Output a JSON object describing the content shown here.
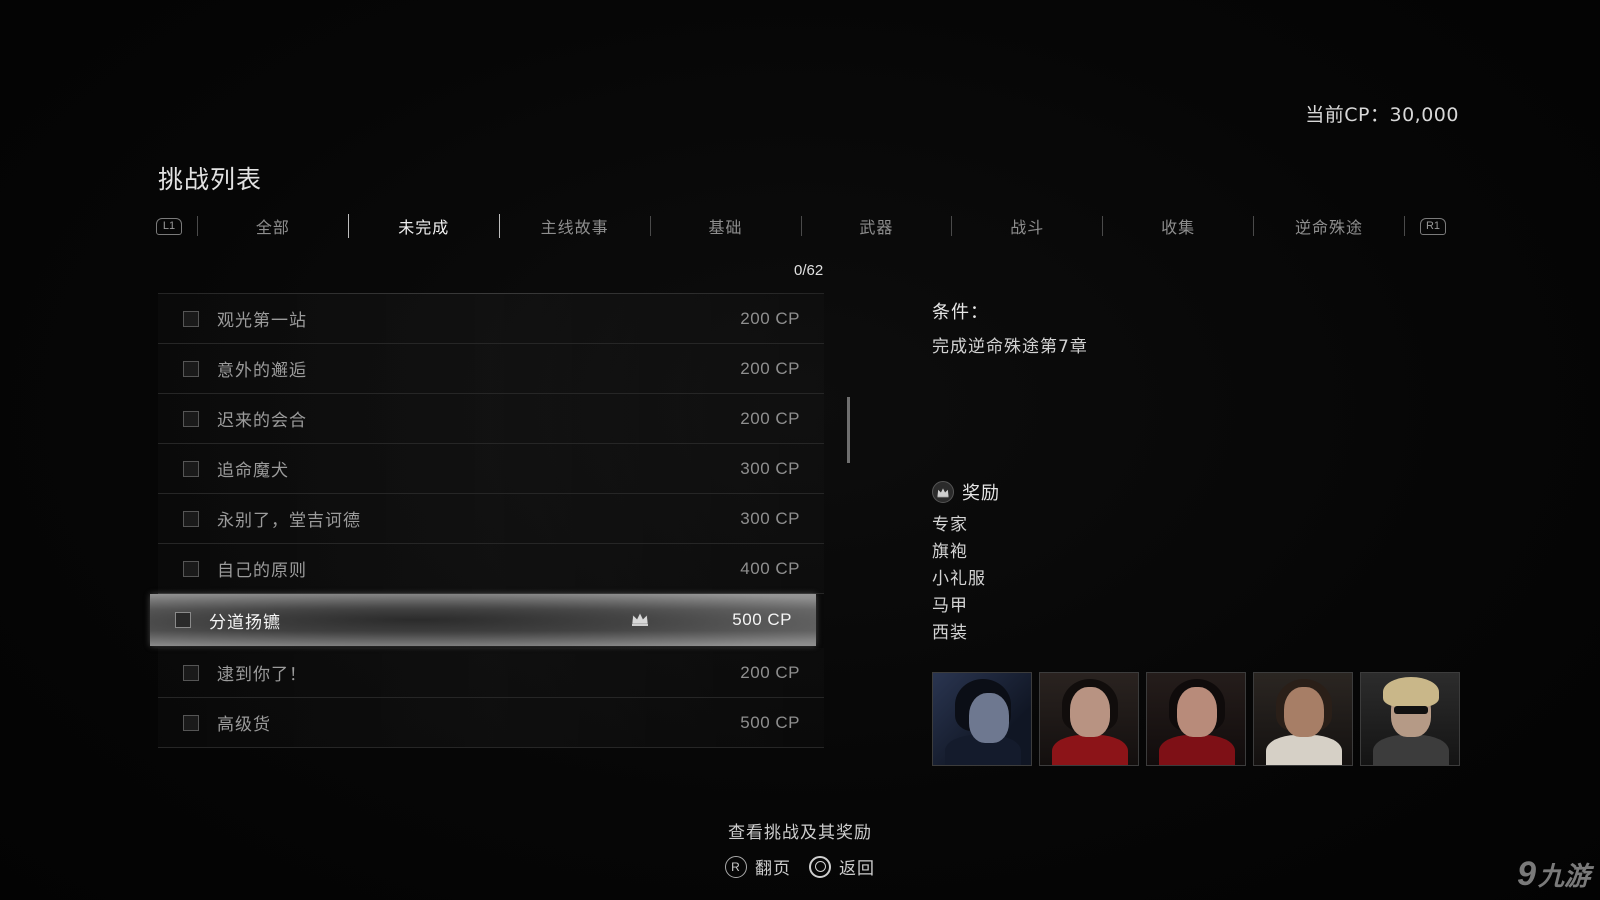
{
  "header": {
    "cp_label": "当前CP：30,000",
    "title": "挑战列表"
  },
  "tabs": {
    "left_shoulder": "L1",
    "right_shoulder": "R1",
    "items": [
      {
        "label": "全部",
        "active": false
      },
      {
        "label": "未完成",
        "active": true
      },
      {
        "label": "主线故事",
        "active": false
      },
      {
        "label": "基础",
        "active": false
      },
      {
        "label": "武器",
        "active": false
      },
      {
        "label": "战斗",
        "active": false
      },
      {
        "label": "收集",
        "active": false
      },
      {
        "label": "逆命殊途",
        "active": false
      }
    ]
  },
  "list": {
    "counter": "0/62",
    "rows": [
      {
        "name": "观光第一站",
        "cp": "200 CP",
        "selected": false
      },
      {
        "name": "意外的邂逅",
        "cp": "200 CP",
        "selected": false
      },
      {
        "name": "迟来的会合",
        "cp": "200 CP",
        "selected": false
      },
      {
        "name": "追命魔犬",
        "cp": "300 CP",
        "selected": false
      },
      {
        "name": "永别了，堂吉诃德",
        "cp": "300 CP",
        "selected": false
      },
      {
        "name": "自己的原则",
        "cp": "400 CP",
        "selected": false
      },
      {
        "name": "分道扬镳",
        "cp": "500 CP",
        "selected": true
      },
      {
        "name": "逮到你了！",
        "cp": "200 CP",
        "selected": false
      },
      {
        "name": "高级货",
        "cp": "500 CP",
        "selected": false
      }
    ]
  },
  "detail": {
    "condition_label": "条件：",
    "condition_text": "完成逆命殊途第7章",
    "reward_label": "奖励",
    "rewards": [
      "专家",
      "旗袍",
      "小礼服",
      "马甲",
      "西装"
    ]
  },
  "footer": {
    "title": "查看挑战及其奖励",
    "page_icon_letter": "R",
    "page_label": "翻页",
    "back_label": "返回"
  },
  "watermark": {
    "mark": "9",
    "text": "九游"
  },
  "colors": {
    "background": "#050505",
    "text_primary": "#e6e6e6",
    "text_muted": "#9b9b9b",
    "selected_highlight": "#9a9a9a"
  },
  "icons": {
    "crown": "crown-icon",
    "back": "circle-button-icon",
    "page": "right-stick-icon"
  }
}
